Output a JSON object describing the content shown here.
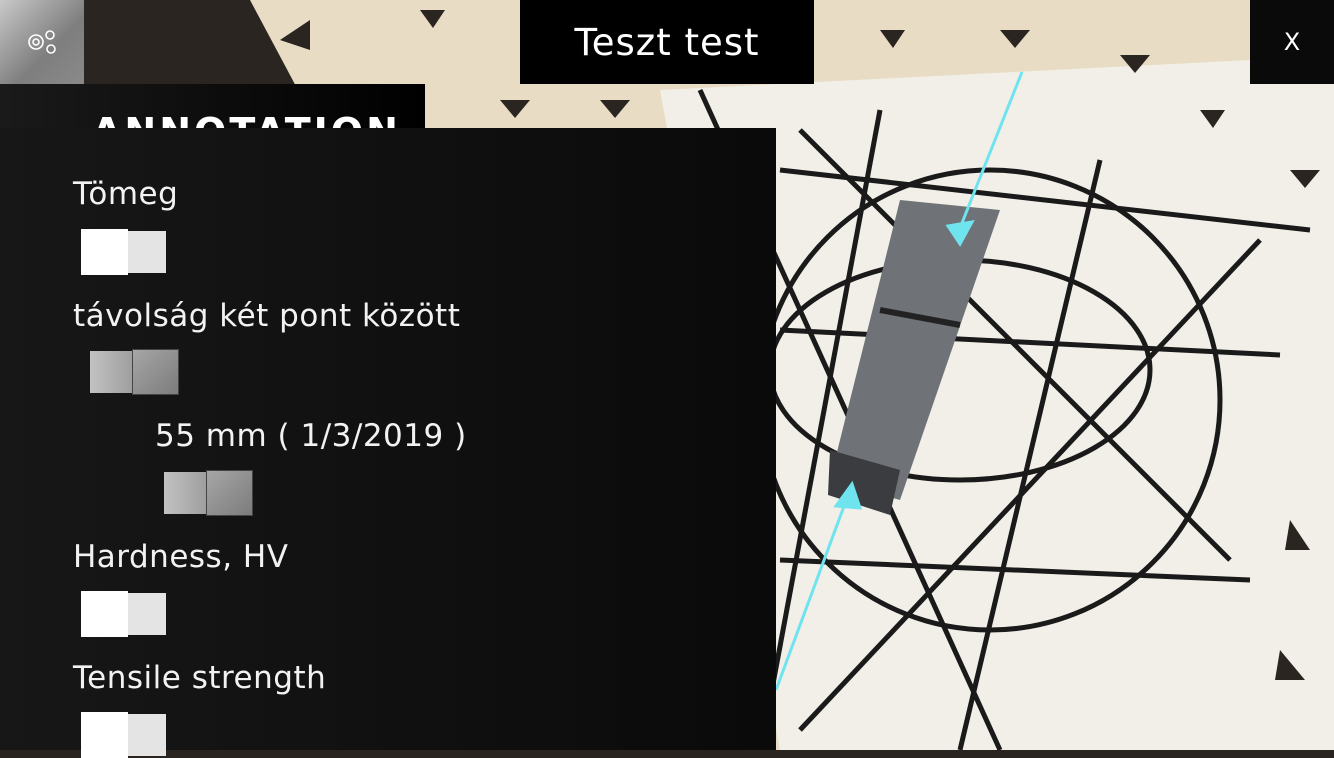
{
  "header": {
    "title": "Teszt test",
    "close_label": "X",
    "settings_icon": "gears-icon"
  },
  "panel": {
    "heading": "ANNOTATION",
    "items": [
      {
        "label": "Tömeg",
        "enabled": false
      },
      {
        "label": "távolság két pont között",
        "enabled": true
      },
      {
        "label": "55 mm ( 1/3/2019 )",
        "enabled": true
      },
      {
        "label": "Hardness, HV",
        "enabled": false
      },
      {
        "label": "Tensile strength",
        "enabled": false
      }
    ]
  },
  "colors": {
    "arrow": "#6fe3ee",
    "panel": "#111111"
  }
}
